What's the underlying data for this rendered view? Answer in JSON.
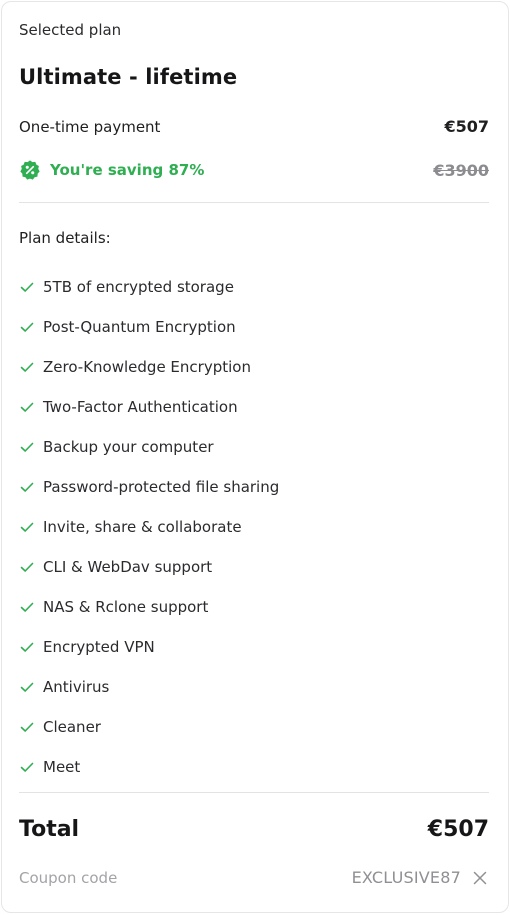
{
  "colors": {
    "accent_green": "#2fae52",
    "text_dark": "#161618",
    "muted": "#8b8b90",
    "divider": "#e3e3e6"
  },
  "header": {
    "selected_label": "Selected plan",
    "plan_title": "Ultimate - lifetime"
  },
  "payment": {
    "label": "One-time payment",
    "price": "€507"
  },
  "saving": {
    "icon": "percent-badge-icon",
    "text": "You're saving 87%",
    "original_price": "€3900"
  },
  "details": {
    "label": "Plan details:",
    "features": [
      {
        "label": "5TB of encrypted storage",
        "icon": "check-icon"
      },
      {
        "label": "Post-Quantum Encryption",
        "icon": "check-icon"
      },
      {
        "label": "Zero-Knowledge Encryption",
        "icon": "check-icon"
      },
      {
        "label": "Two-Factor Authentication",
        "icon": "check-icon"
      },
      {
        "label": "Backup your computer",
        "icon": "check-icon"
      },
      {
        "label": "Password-protected file sharing",
        "icon": "check-icon"
      },
      {
        "label": "Invite, share & collaborate",
        "icon": "check-icon"
      },
      {
        "label": "CLI & WebDav support",
        "icon": "check-icon"
      },
      {
        "label": "NAS & Rclone support",
        "icon": "check-icon"
      },
      {
        "label": "Encrypted VPN",
        "icon": "check-icon"
      },
      {
        "label": "Antivirus",
        "icon": "check-icon"
      },
      {
        "label": "Cleaner",
        "icon": "check-icon"
      },
      {
        "label": "Meet",
        "icon": "check-icon"
      }
    ]
  },
  "total": {
    "label": "Total",
    "price": "€507"
  },
  "coupon": {
    "label": "Coupon code",
    "code": "EXCLUSIVE87",
    "remove_icon": "close-icon"
  }
}
